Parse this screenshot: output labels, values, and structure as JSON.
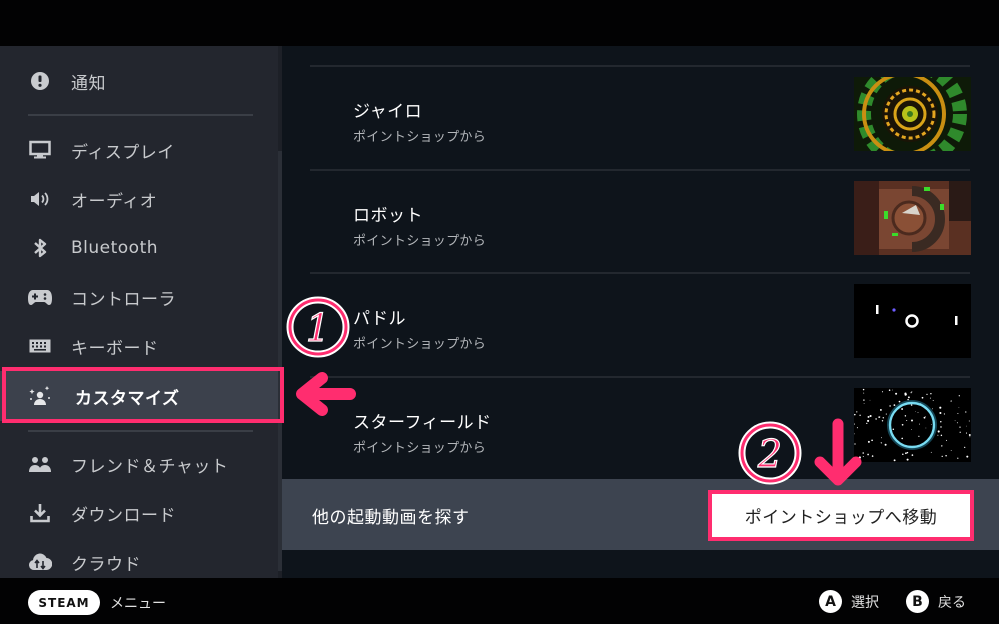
{
  "sidebar": {
    "items": [
      {
        "label": "通知",
        "icon": "alert-icon"
      },
      {
        "label": "ディスプレイ",
        "icon": "monitor-icon"
      },
      {
        "label": "オーディオ",
        "icon": "speaker-icon"
      },
      {
        "label": "Bluetooth",
        "icon": "bluetooth-icon"
      },
      {
        "label": "コントローラ",
        "icon": "gamepad-icon"
      },
      {
        "label": "キーボード",
        "icon": "keyboard-icon"
      },
      {
        "label": "カスタマイズ",
        "icon": "customize-sparkle-icon",
        "active": true
      },
      {
        "label": "フレンド＆チャット",
        "icon": "friends-icon"
      },
      {
        "label": "ダウンロード",
        "icon": "download-icon"
      },
      {
        "label": "クラウド",
        "icon": "cloud-sync-icon"
      }
    ]
  },
  "content": {
    "videos": [
      {
        "title": "ジャイロ",
        "source": "ポイントショップから",
        "thumbnail": "gyro-swirl"
      },
      {
        "title": "ロボット",
        "source": "ポイントショップから",
        "thumbnail": "robot-scene"
      },
      {
        "title": "パドル",
        "source": "ポイントショップから",
        "thumbnail": "paddle-pong"
      },
      {
        "title": "スターフィールド",
        "source": "ポイントショップから",
        "thumbnail": "starfield-ring"
      }
    ],
    "find_more": {
      "label": "他の起動動画を探す",
      "button_label": "ポイントショップへ移動"
    }
  },
  "annotations": {
    "step1": "1",
    "step2": "2",
    "color": "#ff2d6f"
  },
  "footer": {
    "steam_label": "STEAM",
    "menu_label": "メニュー",
    "hints": [
      {
        "button": "A",
        "label": "選択"
      },
      {
        "button": "B",
        "label": "戻る"
      }
    ]
  }
}
